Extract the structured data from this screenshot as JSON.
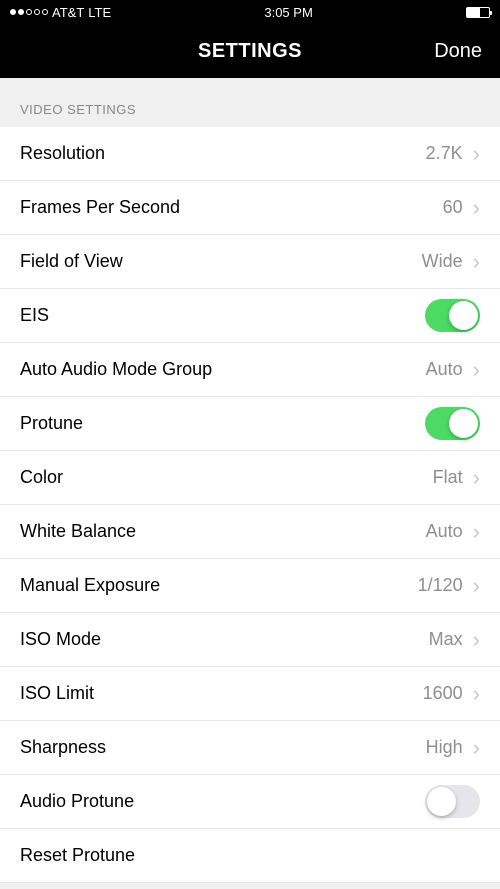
{
  "status": {
    "carrier": "AT&T",
    "network": "LTE",
    "time": "3:05 PM"
  },
  "nav": {
    "title": "SETTINGS",
    "done": "Done"
  },
  "section": {
    "title": "VIDEO SETTINGS"
  },
  "rows": {
    "resolution": {
      "label": "Resolution",
      "value": "2.7K"
    },
    "fps": {
      "label": "Frames Per Second",
      "value": "60"
    },
    "fov": {
      "label": "Field of View",
      "value": "Wide"
    },
    "eis": {
      "label": "EIS",
      "toggle": true
    },
    "audio_mode": {
      "label": "Auto Audio Mode Group",
      "value": "Auto"
    },
    "protune": {
      "label": "Protune",
      "toggle": true
    },
    "color": {
      "label": "Color",
      "value": "Flat"
    },
    "white_balance": {
      "label": "White Balance",
      "value": "Auto"
    },
    "manual_exposure": {
      "label": "Manual Exposure",
      "value": "1/120"
    },
    "iso_mode": {
      "label": "ISO Mode",
      "value": "Max"
    },
    "iso_limit": {
      "label": "ISO Limit",
      "value": "1600"
    },
    "sharpness": {
      "label": "Sharpness",
      "value": "High"
    },
    "audio_protune": {
      "label": "Audio Protune",
      "toggle": false
    },
    "reset_protune": {
      "label": "Reset Protune"
    }
  }
}
